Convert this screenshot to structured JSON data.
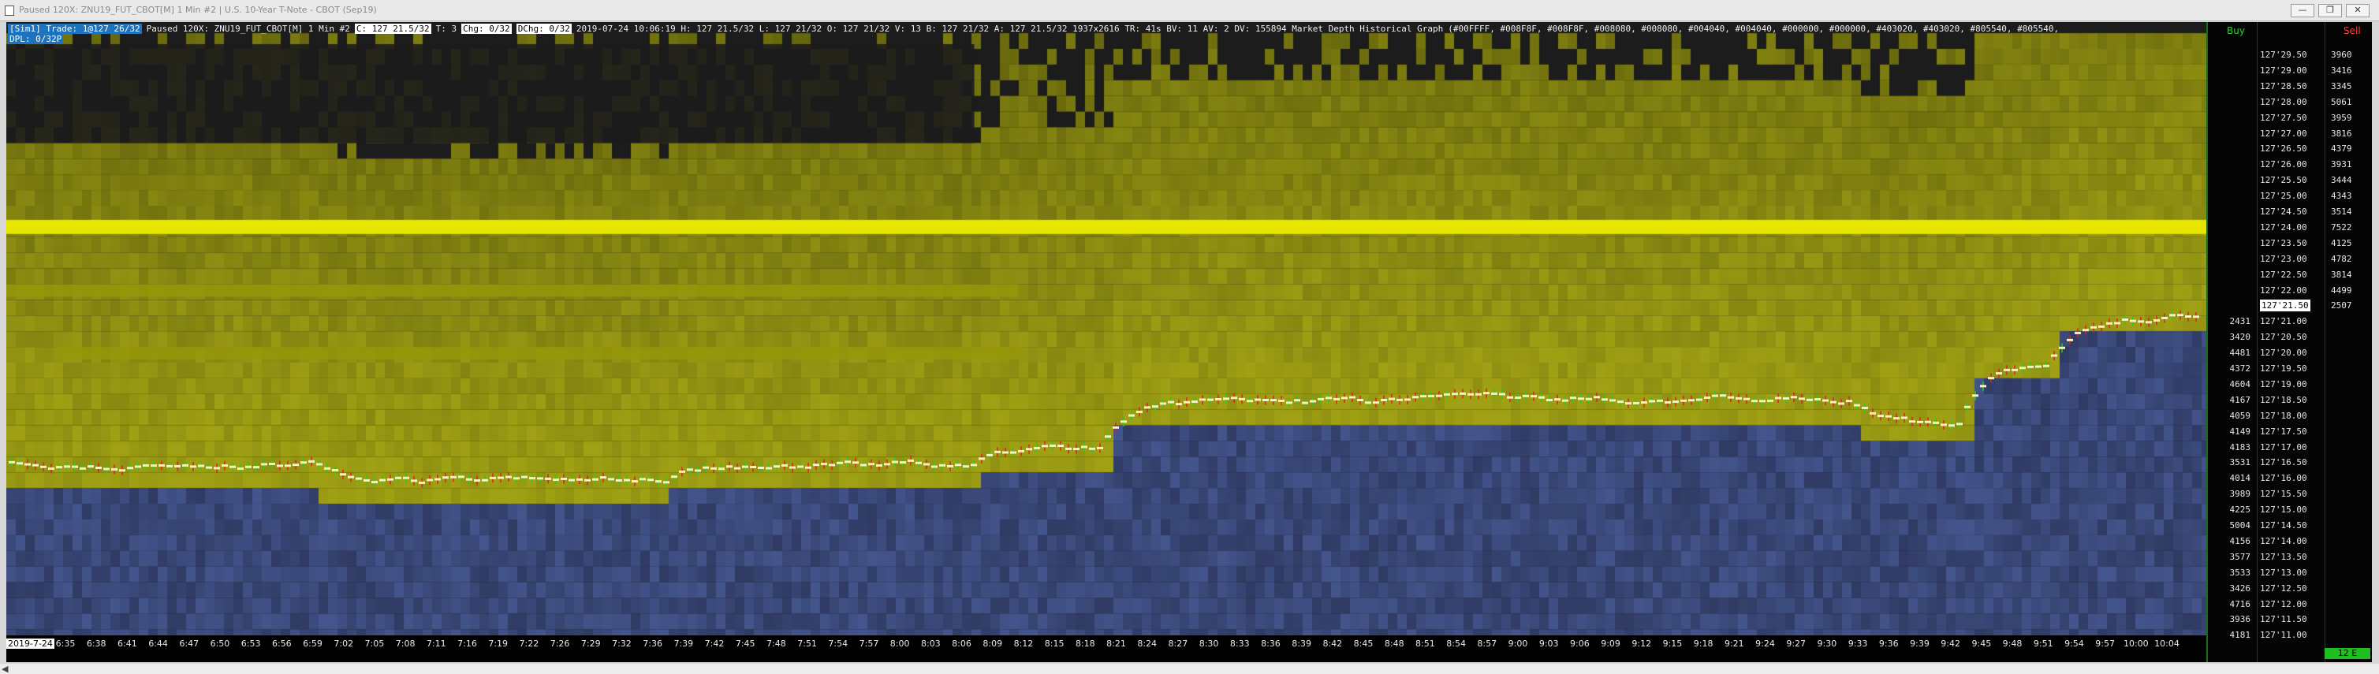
{
  "window": {
    "title": "Paused 120X: ZNU19_FUT_CBOT[M]  1 Min  #2 | U.S. 10-Year T-Note - CBOT (Sep19)",
    "controls": {
      "minimize": "—",
      "restore": "❐",
      "close": "✕"
    }
  },
  "header": {
    "row1": [
      {
        "text": "[Sim1]  Trade: 1@127 26/32",
        "style": "blue"
      },
      {
        "text": "Paused 120X: ZNU19_FUT_CBOT[M]  1 Min  #2",
        "style": "plain"
      },
      {
        "text": "C: 127 21.5/32",
        "style": "white"
      },
      {
        "text": "T: 3",
        "style": "plain"
      },
      {
        "text": "Chg: 0/32",
        "style": "white"
      },
      {
        "text": "DChg: 0/32",
        "style": "white"
      },
      {
        "text": "2019-07-24 10:06:19  H: 127 21.5/32  L: 127 21/32  O: 127 21/32  V: 13  B: 127 21/32  A: 127 21.5/32  1937x2616  TR: 41s  BV: 11  AV: 2  DV: 155894  Market Depth Historical Graph",
        "style": "plain"
      },
      {
        "text": "(#00FFFF, #008F8F, #008F8F, #008080, #008080, #004040, #004040, #000000, #000000, #403020, #403020, #805540, #805540,",
        "style": "plain"
      }
    ],
    "row2": [
      {
        "text": "DPL: 0/32P",
        "style": "blue"
      }
    ]
  },
  "ladder": {
    "buy_label": "Buy",
    "sell_label": "Sell",
    "prices": [
      "127'29.50",
      "127'29.00",
      "127'28.50",
      "127'28.00",
      "127'27.50",
      "127'27.00",
      "127'26.50",
      "127'26.00",
      "127'25.50",
      "127'25.00",
      "127'24.50",
      "127'24.00",
      "127'23.50",
      "127'23.00",
      "127'22.50",
      "127'22.00",
      "127'21.50",
      "127'21.00",
      "127'20.50",
      "127'20.00",
      "127'19.50",
      "127'19.00",
      "127'18.50",
      "127'18.00",
      "127'17.50",
      "127'17.00",
      "127'16.50",
      "127'16.00",
      "127'15.50",
      "127'15.00",
      "127'14.50",
      "127'14.00",
      "127'13.50",
      "127'13.00",
      "127'12.50",
      "127'12.00",
      "127'11.50",
      "127'11.00"
    ],
    "current_price": "127'21.50",
    "asks": [
      "3960",
      "3416",
      "3345",
      "5061",
      "3959",
      "3816",
      "4379",
      "3931",
      "3444",
      "4343",
      "3514",
      "7522",
      "4125",
      "4782",
      "3814",
      "4499",
      "2507"
    ],
    "bids": [
      "2431",
      "3420",
      "4481",
      "4372",
      "4604",
      "4167",
      "4059",
      "4149",
      "4183",
      "3531",
      "4014",
      "3989",
      "4225",
      "5004",
      "4156",
      "3577",
      "3533",
      "3426",
      "4716",
      "3936",
      "4181"
    ],
    "footer": "12 E"
  },
  "time_axis": {
    "first_label": "2019-7-24",
    "labels": [
      "6:35",
      "6:38",
      "6:41",
      "6:44",
      "6:47",
      "6:50",
      "6:53",
      "6:56",
      "6:59",
      "7:02",
      "7:05",
      "7:08",
      "7:11",
      "7:16",
      "7:19",
      "7:22",
      "7:26",
      "7:29",
      "7:32",
      "7:36",
      "7:39",
      "7:42",
      "7:45",
      "7:48",
      "7:51",
      "7:54",
      "7:57",
      "8:00",
      "8:03",
      "8:06",
      "8:09",
      "8:12",
      "8:15",
      "8:18",
      "8:21",
      "8:24",
      "8:27",
      "8:30",
      "8:33",
      "8:36",
      "8:39",
      "8:42",
      "8:45",
      "8:48",
      "8:51",
      "8:54",
      "8:57",
      "9:00",
      "9:03",
      "9:06",
      "9:09",
      "9:12",
      "9:15",
      "9:18",
      "9:21",
      "9:24",
      "9:27",
      "9:30",
      "9:33",
      "9:36",
      "9:39",
      "9:42",
      "9:45",
      "9:48",
      "9:51",
      "9:54",
      "9:57",
      "10:00",
      "10:04"
    ]
  },
  "colors": {
    "background": "#1c1c1c",
    "bid_depth": "#5a6a98",
    "ask_depth": "#8a8a10",
    "big_ask_level": "#e6e600",
    "last_price_bar": "#f4f4c0",
    "up_tick": "#20d020",
    "down_tick": "#e02020",
    "buy_label": "#2fcf2f",
    "sell_label": "#ff4040"
  }
}
